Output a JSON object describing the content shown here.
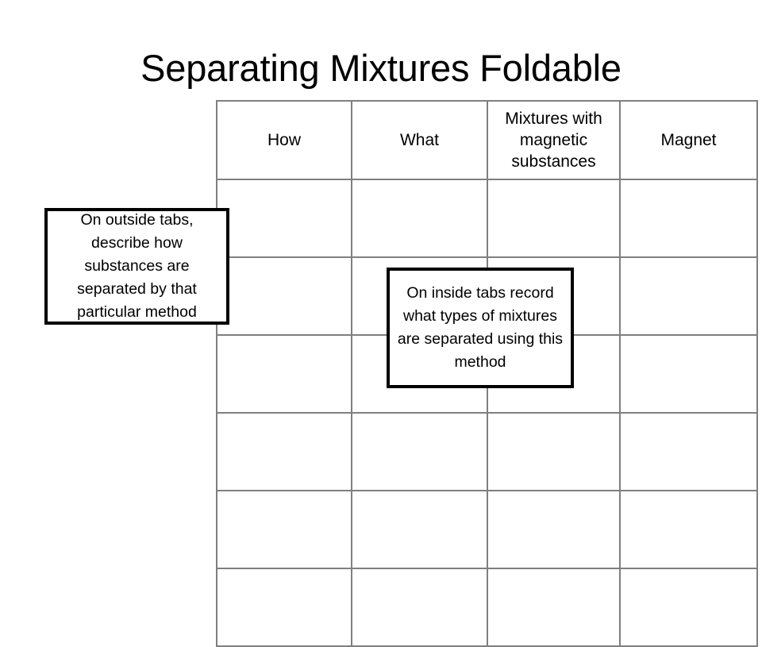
{
  "slide": {
    "title": "Separating Mixtures Foldable",
    "background_color": "#ffffff",
    "text_color": "#000000"
  },
  "table": {
    "grid_line_color": "#7f7f7f",
    "column_count": 4,
    "row_count": 7,
    "headers": [
      "How",
      "What",
      "Mixtures with magnetic substances",
      "Magnet"
    ],
    "body_rows": [
      [
        "",
        "",
        "",
        ""
      ],
      [
        "",
        "",
        "",
        ""
      ],
      [
        "",
        "",
        "",
        ""
      ],
      [
        "",
        "",
        "",
        ""
      ],
      [
        "",
        "",
        "",
        ""
      ],
      [
        "",
        "",
        "",
        ""
      ]
    ]
  },
  "callouts": {
    "outside_tabs": {
      "text": "On outside tabs, describe how substances are separated by that particular method",
      "border_color": "#000000",
      "fill_color": "#ffffff"
    },
    "inside_tabs": {
      "text": "On inside tabs record what types of mixtures are separated using this method",
      "border_color": "#000000",
      "fill_color": "#ffffff"
    }
  }
}
